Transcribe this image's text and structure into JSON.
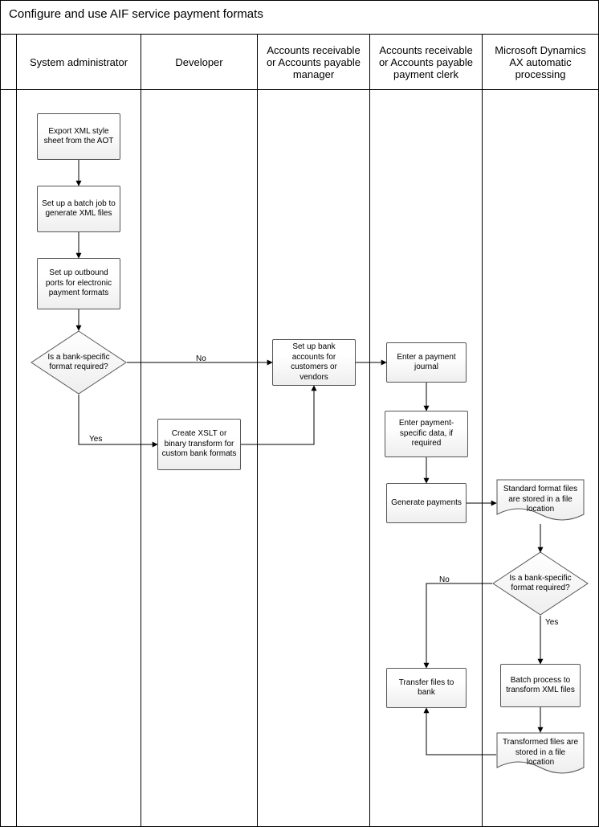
{
  "title": "Configure and use AIF service payment formats",
  "lanes": {
    "l1": "System administrator",
    "l2": "Developer",
    "l3": "Accounts receivable or Accounts payable manager",
    "l4": "Accounts receivable or Accounts payable payment clerk",
    "l5": "Microsoft Dynamics AX automatic processing"
  },
  "nodes": {
    "n_export": "Export XML style sheet from the AOT",
    "n_batch": "Set up a batch job to generate XML files",
    "n_ports": "Set up outbound ports for electronic payment formats",
    "n_dec1": "Is a bank-specific format required?",
    "n_xslt": "Create XSLT or binary transform for custom bank formats",
    "n_bankacct": "Set up bank accounts for customers or vendors",
    "n_journal": "Enter a payment journal",
    "n_paydata": "Enter payment-specific data, if required",
    "n_genpay": "Generate payments",
    "n_stdfiles": "Standard format files are stored in a file location",
    "n_dec2": "Is a bank-specific format required?",
    "n_batchxfm": "Batch process to transform XML files",
    "n_xfmfiles": "Transformed files are stored in a file location",
    "n_transfer": "Transfer files to bank"
  },
  "labels": {
    "yes": "Yes",
    "no": "No"
  }
}
